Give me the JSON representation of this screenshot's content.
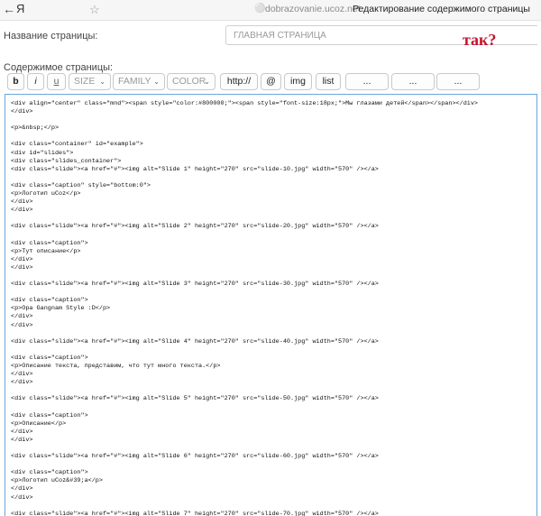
{
  "browser": {
    "yandex_label": "Я",
    "back_glyph": "←",
    "bookmark_glyph": "☆",
    "lock_glyph": "🔒",
    "domain": "dobrazovanie.ucoz.net",
    "page_title": "Редактирование содержимого страницы"
  },
  "form": {
    "name_label": "Название страницы:",
    "name_value": "ГЛАВНАЯ СТРАНИЦА",
    "annotation": "так?",
    "content_label": "Содержимое страницы:"
  },
  "toolbar": {
    "bold": "b",
    "italic": "i",
    "underline": "u",
    "size": "SIZE",
    "family": "FAMILY",
    "color": "COLOR",
    "link": "http://",
    "email": "@",
    "image": "img",
    "list": "list",
    "extra1": "...",
    "extra2": "...",
    "extra3": "...",
    "caret": "⌄"
  },
  "editor": {
    "code": "<div align=\"center\" class=\"mnd\"><span style=\"color:#800000;\"><span style=\"font-size:18px;\">Мы глазами детей</span></span></div>\n</div>\n\n<p>&nbsp;</p>\n\n<div class=\"container\" id=\"example\">\n<div id=\"slides\">\n<div class=\"slides_container\">\n<div class=\"slide\"><a href=\"#\"><img alt=\"Slide 1\" height=\"270\" src=\"slide-10.jpg\" width=\"570\" /></a>\n\n<div class=\"caption\" style=\"bottom:0\">\n<p>Логотип uCoz</p>\n</div>\n</div>\n\n<div class=\"slide\"><a href=\"#\"><img alt=\"Slide 2\" height=\"270\" src=\"slide-20.jpg\" width=\"570\" /></a>\n\n<div class=\"caption\">\n<p>Тут описание</p>\n</div>\n</div>\n\n<div class=\"slide\"><a href=\"#\"><img alt=\"Slide 3\" height=\"270\" src=\"slide-30.jpg\" width=\"570\" /></a>\n\n<div class=\"caption\">\n<p>Opa Gangnam Style :D</p>\n</div>\n</div>\n\n<div class=\"slide\"><a href=\"#\"><img alt=\"Slide 4\" height=\"270\" src=\"slide-40.jpg\" width=\"570\" /></a>\n\n<div class=\"caption\">\n<p>Описание текста, представим, что тут много текста.</p>\n</div>\n</div>\n\n<div class=\"slide\"><a href=\"#\"><img alt=\"Slide 5\" height=\"270\" src=\"slide-50.jpg\" width=\"570\" /></a>\n\n<div class=\"caption\">\n<p>Описание</p>\n</div>\n</div>\n\n<div class=\"slide\"><a href=\"#\"><img alt=\"Slide 6\" height=\"270\" src=\"slide-60.jpg\" width=\"570\" /></a>\n\n<div class=\"caption\">\n<p>Логотип uCoz&#39;a</p>\n</div>\n</div>\n\n<div class=\"slide\"><a href=\"#\"><img alt=\"Slide 7\" height=\"270\" src=\"slide-70.jpg\" width=\"570\" /></a>"
  }
}
